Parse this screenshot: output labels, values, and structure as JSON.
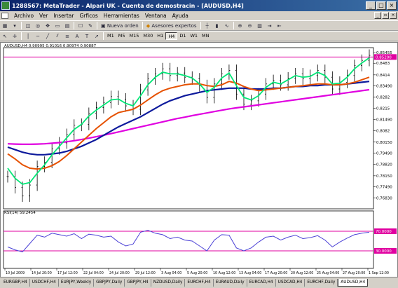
{
  "window": {
    "title": "1288567: MetaTrader - Alpari UK - Cuenta de demostracin - [AUDUSD,H4]",
    "controls": [
      "_",
      "□",
      "×"
    ]
  },
  "menu": {
    "items": [
      "Archivo",
      "Ver",
      "Insertar",
      "Grficos",
      "Herramientas",
      "Ventana",
      "Ayuda"
    ]
  },
  "toolbar": {
    "new_order_label": "Nueva orden",
    "expert_advisors_label": "Asesores expertos",
    "timeframes": [
      "M1",
      "M5",
      "M15",
      "M30",
      "H1",
      "H4",
      "D1",
      "W1",
      "MN"
    ],
    "active_timeframe": "H4"
  },
  "chart": {
    "header": "AUDUSD,H4  0.90995 0.91016 0.90974 0.90887",
    "indicator_label": "RSI(14) 59.2454",
    "colors": {
      "price_bars": "#000000",
      "ma_fast": "#00e676",
      "ma_mid": "#e65100",
      "ma_slow": "#0d1a9c",
      "ma_long": "#e000e0",
      "levels": "#e000a0",
      "rsi": "#4b41d6"
    }
  },
  "chart_data": {
    "type": "line",
    "title": "AUDUSD,H4",
    "price_axis": {
      "ylim": [
        0.7623,
        0.8563
      ],
      "ticks": [
        0.85455,
        0.8483,
        0.8414,
        0.8349,
        0.8282,
        0.8215,
        0.8149,
        0.8082,
        0.8015,
        0.7949,
        0.7882,
        0.7815,
        0.7749,
        0.7683
      ],
      "tick_labels": [
        "0.85455",
        "0.8483",
        "0.8414",
        "0.83490",
        "0.8282",
        "0.8215",
        "0.81490",
        "0.8082",
        "0.80150",
        "0.79490",
        "0.78820",
        "0.78150",
        "0.77490",
        "0.76830"
      ],
      "highlight_level": 0.852,
      "highlight_label": "0.85200"
    },
    "x_labels": [
      "10 Jul 2009",
      "14 Jul 20:00",
      "17 Jul 12:00",
      "22 Jul 04:00",
      "24 Jul 20:00",
      "29 Jul 12:00",
      "3 Aug 04:00",
      "5 Aug 20:00",
      "10 Aug 12:00",
      "13 Aug 04:00",
      "17 Aug 20:00",
      "20 Aug 12:00",
      "25 Aug 04:00",
      "27 Aug 20:00",
      "1 Sep 12:00"
    ],
    "price_series": [
      {
        "name": "close",
        "values": [
          0.781,
          0.7745,
          0.7695,
          0.776,
          0.787,
          0.7895,
          0.7975,
          0.801,
          0.806,
          0.8115,
          0.812,
          0.8185,
          0.822,
          0.825,
          0.8285,
          0.827,
          0.823,
          0.821,
          0.8325,
          0.839,
          0.842,
          0.845,
          0.841,
          0.8425,
          0.84,
          0.839,
          0.835,
          0.828,
          0.836,
          0.842,
          0.844,
          0.83,
          0.824,
          0.826,
          0.83,
          0.836,
          0.838,
          0.8355,
          0.8395,
          0.842,
          0.839,
          0.841,
          0.844,
          0.84,
          0.833,
          0.837,
          0.841,
          0.847,
          0.85,
          0.853
        ]
      },
      {
        "name": "ma_fast",
        "values": [
          0.786,
          0.78,
          0.7765,
          0.7775,
          0.783,
          0.788,
          0.794,
          0.799,
          0.804,
          0.809,
          0.812,
          0.817,
          0.8205,
          0.8235,
          0.8265,
          0.827,
          0.8245,
          0.823,
          0.829,
          0.8355,
          0.84,
          0.843,
          0.842,
          0.842,
          0.841,
          0.8395,
          0.836,
          0.831,
          0.834,
          0.8395,
          0.8425,
          0.835,
          0.828,
          0.8265,
          0.829,
          0.834,
          0.837,
          0.836,
          0.8385,
          0.841,
          0.84,
          0.8405,
          0.843,
          0.841,
          0.836,
          0.8365,
          0.84,
          0.845,
          0.8485,
          0.8515
        ]
      },
      {
        "name": "ma_mid",
        "values": [
          0.7945,
          0.7915,
          0.788,
          0.786,
          0.7855,
          0.786,
          0.7875,
          0.79,
          0.7935,
          0.7975,
          0.8015,
          0.8055,
          0.8095,
          0.813,
          0.8165,
          0.819,
          0.82,
          0.821,
          0.8235,
          0.8265,
          0.8295,
          0.832,
          0.8335,
          0.8345,
          0.8355,
          0.836,
          0.836,
          0.835,
          0.8345,
          0.8355,
          0.8375,
          0.8365,
          0.8345,
          0.833,
          0.832,
          0.8325,
          0.833,
          0.8335,
          0.834,
          0.8345,
          0.835,
          0.8355,
          0.836,
          0.836,
          0.8355,
          0.8355,
          0.836,
          0.837,
          0.8385,
          0.84
        ]
      },
      {
        "name": "ma_slow",
        "values": [
          0.7985,
          0.797,
          0.7955,
          0.7945,
          0.794,
          0.794,
          0.7945,
          0.795,
          0.796,
          0.7975,
          0.799,
          0.801,
          0.803,
          0.8055,
          0.808,
          0.8105,
          0.8125,
          0.8145,
          0.8165,
          0.819,
          0.8215,
          0.824,
          0.826,
          0.8275,
          0.829,
          0.83,
          0.831,
          0.832,
          0.8325,
          0.833,
          0.8335,
          0.8335,
          0.8335,
          0.833,
          0.833,
          0.833,
          0.8335,
          0.8335,
          0.834,
          0.8345,
          0.8345,
          0.835,
          0.835,
          0.8355,
          0.8355,
          0.8355,
          0.836,
          0.8365,
          0.837,
          0.8375
        ]
      },
      {
        "name": "ma_long",
        "values": [
          0.8005,
          0.8003,
          0.8002,
          0.8002,
          0.8003,
          0.8005,
          0.8008,
          0.8012,
          0.8017,
          0.8023,
          0.803,
          0.8038,
          0.8047,
          0.8056,
          0.8065,
          0.8075,
          0.8085,
          0.8095,
          0.8105,
          0.8115,
          0.8125,
          0.8135,
          0.8145,
          0.8155,
          0.8163,
          0.8172,
          0.818,
          0.8188,
          0.8196,
          0.8204,
          0.8212,
          0.8218,
          0.8224,
          0.823,
          0.8236,
          0.8242,
          0.8248,
          0.8254,
          0.826,
          0.8266,
          0.8272,
          0.8278,
          0.8284,
          0.829,
          0.8296,
          0.8302,
          0.8308,
          0.8314,
          0.832,
          0.8326
        ]
      }
    ],
    "rsi": {
      "ylim": [
        0,
        100
      ],
      "levels": [
        70,
        30
      ],
      "level_labels": [
        "70.0000",
        "30.0000"
      ],
      "values": [
        38,
        32,
        28,
        45,
        62,
        58,
        66,
        63,
        60,
        65,
        55,
        64,
        62,
        58,
        60,
        48,
        40,
        44,
        68,
        72,
        66,
        63,
        55,
        58,
        52,
        50,
        40,
        30,
        52,
        63,
        62,
        36,
        30,
        36,
        48,
        58,
        60,
        52,
        58,
        62,
        55,
        57,
        61,
        52,
        38,
        48,
        56,
        63,
        66,
        68
      ]
    }
  },
  "tabs": {
    "items": [
      "EURGBP,H4",
      "USDCHF,H4",
      "EURJPY,Weekly",
      "GBPJPY,Daily",
      "GBPJPY,H4",
      "NZDUSD,Daily",
      "EURCHF,H4",
      "EURAUD,Daily",
      "EURCAD,H4",
      "USDCAD,H4",
      "EURCHF,Daily",
      "AUDUSD,H4"
    ],
    "active": "AUDUSD,H4"
  }
}
